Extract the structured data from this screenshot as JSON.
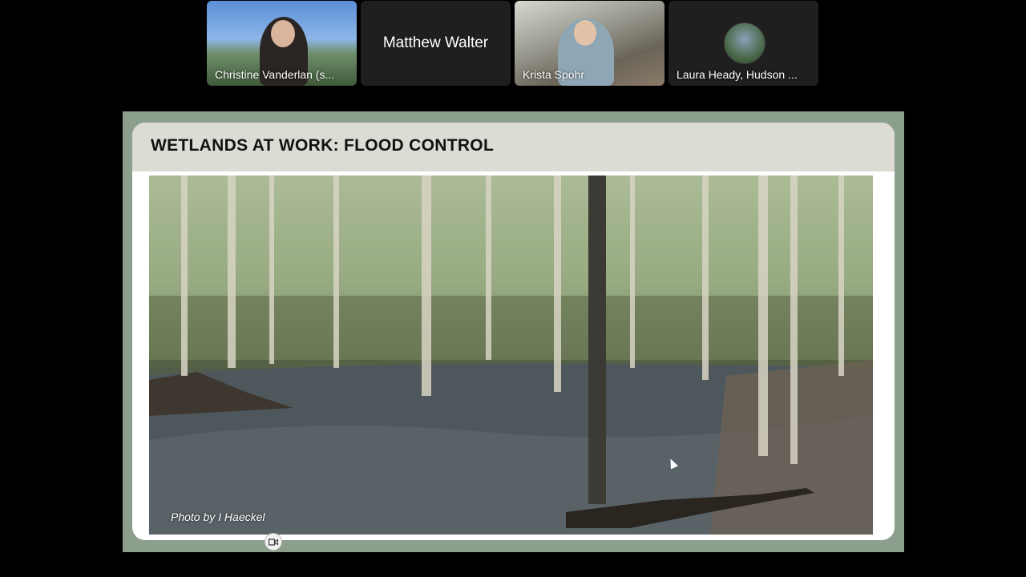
{
  "participants": [
    {
      "name": "Christine Vanderlan (s..."
    },
    {
      "name": "Matthew Walter"
    },
    {
      "name": "Krista Spohr"
    },
    {
      "name": "Laura Heady, Hudson ..."
    }
  ],
  "slide": {
    "title": "WETLANDS AT WORK: FLOOD CONTROL",
    "caption": "Photo by I Haeckel"
  },
  "icons": {
    "camera": "video-camera-icon",
    "cursor": "mouse-pointer-icon"
  },
  "colors": {
    "background": "#000000",
    "slide_frame": "#8c9e8c",
    "slide_header": "#dcdcd4"
  }
}
